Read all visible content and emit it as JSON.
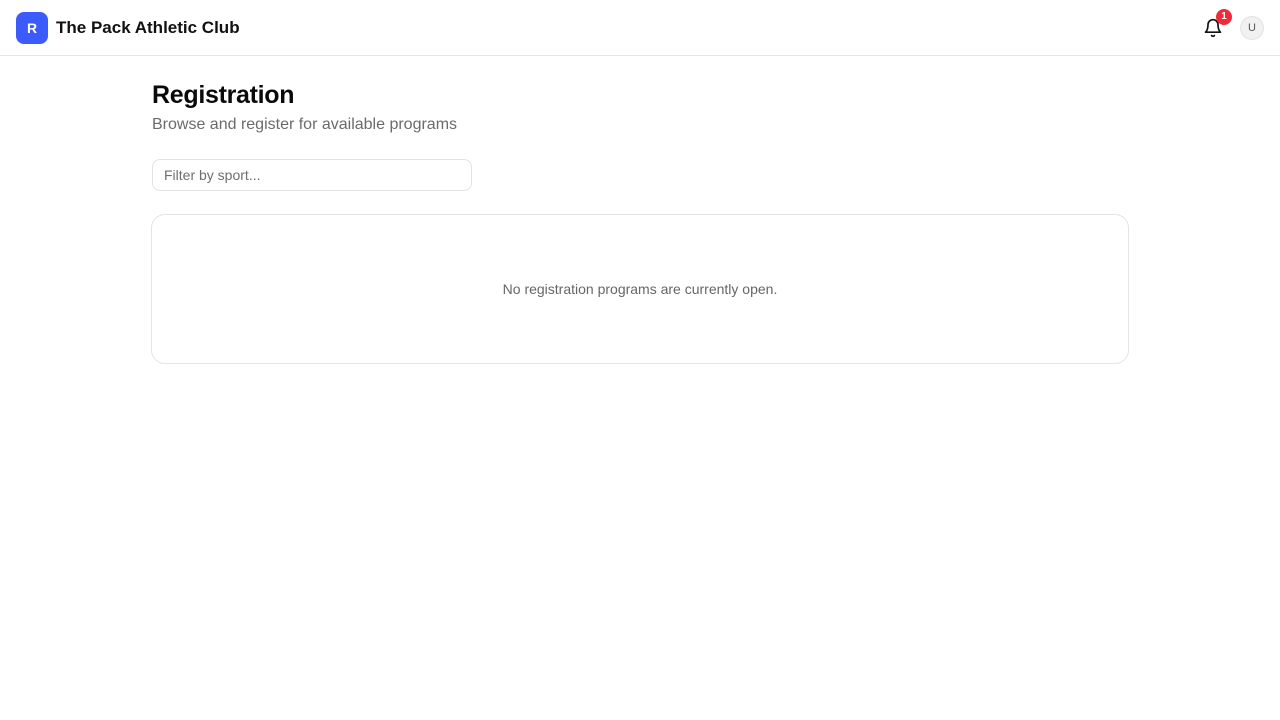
{
  "header": {
    "logo_letter": "R",
    "club_name": "The Pack Athletic Club",
    "notification_count": "1",
    "avatar_initial": "U"
  },
  "main": {
    "title": "Registration",
    "subtitle": "Browse and register for available programs",
    "filter": {
      "value": "",
      "placeholder": "Filter by sport..."
    },
    "empty_message": "No registration programs are currently open."
  },
  "colors": {
    "brand": "#3b5bfd",
    "badge": "#ef2b3b",
    "border": "#e4e4e4"
  },
  "icons": {
    "notifications": "bell-icon"
  }
}
